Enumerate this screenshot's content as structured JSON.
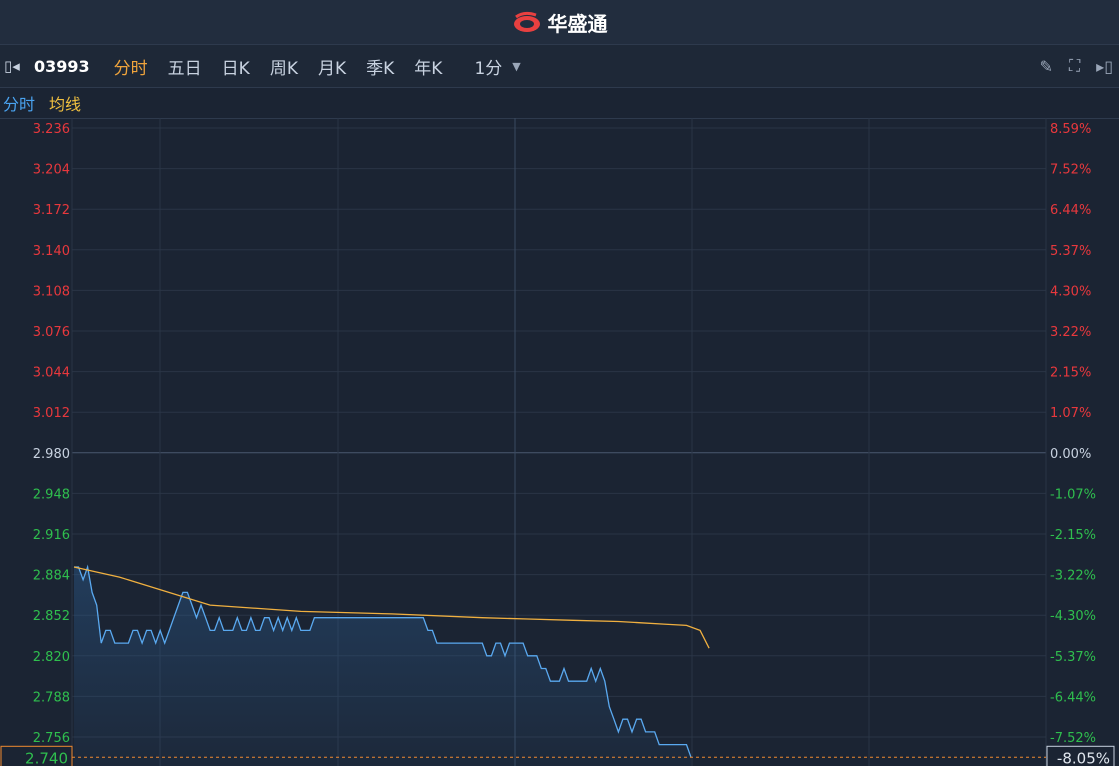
{
  "app": {
    "brand": "华盛通"
  },
  "toolbar": {
    "code": "03993",
    "tabs": [
      "分时",
      "五日",
      "日K",
      "周K",
      "月K",
      "季K",
      "年K"
    ],
    "active_tab": 0,
    "interval": "1分"
  },
  "legend": {
    "series1": "分时",
    "series2": "均线"
  },
  "colors": {
    "up": "#e8383d",
    "down": "#2fbf4e",
    "flat": "#c8d2e0",
    "price_line": "#5aa9f0",
    "avg_line": "#f0b040",
    "current": "#f08a30"
  },
  "chart_data": {
    "type": "line",
    "base_price": 2.98,
    "ylim": [
      2.74,
      3.236
    ],
    "price_ticks": [
      "3.236",
      "3.204",
      "3.172",
      "3.140",
      "3.108",
      "3.076",
      "3.044",
      "3.012",
      "2.980",
      "2.948",
      "2.916",
      "2.884",
      "2.852",
      "2.820",
      "2.788",
      "2.756"
    ],
    "pct_ticks": [
      "8.59%",
      "7.52%",
      "6.44%",
      "5.37%",
      "4.30%",
      "3.22%",
      "2.15%",
      "1.07%",
      "0.00%",
      "-1.07%",
      "-2.15%",
      "-3.22%",
      "-4.30%",
      "-5.37%",
      "-6.44%",
      "-7.52%"
    ],
    "current_price": "2.740",
    "current_pct": "-8.05%",
    "series": [
      {
        "name": "分时",
        "values": [
          2.89,
          2.89,
          2.88,
          2.89,
          2.87,
          2.86,
          2.83,
          2.84,
          2.84,
          2.83,
          2.83,
          2.83,
          2.83,
          2.84,
          2.84,
          2.83,
          2.84,
          2.84,
          2.83,
          2.84,
          2.83,
          2.84,
          2.85,
          2.86,
          2.87,
          2.87,
          2.86,
          2.85,
          2.86,
          2.85,
          2.84,
          2.84,
          2.85,
          2.84,
          2.84,
          2.84,
          2.85,
          2.84,
          2.84,
          2.85,
          2.84,
          2.84,
          2.85,
          2.85,
          2.84,
          2.85,
          2.84,
          2.85,
          2.84,
          2.85,
          2.84,
          2.84,
          2.84,
          2.85,
          2.85,
          2.85,
          2.85,
          2.85,
          2.85,
          2.85,
          2.85,
          2.85,
          2.85,
          2.85,
          2.85,
          2.85,
          2.85,
          2.85,
          2.85,
          2.85,
          2.85,
          2.85,
          2.85,
          2.85,
          2.85,
          2.85,
          2.85,
          2.85,
          2.84,
          2.84,
          2.83,
          2.83,
          2.83,
          2.83,
          2.83,
          2.83,
          2.83,
          2.83,
          2.83,
          2.83,
          2.83,
          2.82,
          2.82,
          2.83,
          2.83,
          2.82,
          2.83,
          2.83,
          2.83,
          2.83,
          2.82,
          2.82,
          2.82,
          2.81,
          2.81,
          2.8,
          2.8,
          2.8,
          2.81,
          2.8,
          2.8,
          2.8,
          2.8,
          2.8,
          2.81,
          2.8,
          2.81,
          2.8,
          2.78,
          2.77,
          2.76,
          2.77,
          2.77,
          2.76,
          2.77,
          2.77,
          2.76,
          2.76,
          2.76,
          2.75,
          2.75,
          2.75,
          2.75,
          2.75,
          2.75,
          2.75,
          2.74
        ]
      },
      {
        "name": "均线",
        "values": [
          2.89,
          2.882,
          2.86,
          2.855,
          2.853,
          2.85,
          2.849,
          2.848,
          2.847,
          2.846,
          2.845,
          2.844,
          2.84,
          2.826
        ]
      }
    ],
    "avg_x_positions": [
      0,
      10,
      30,
      50,
      70,
      90,
      100,
      110,
      120,
      125,
      130,
      135,
      138,
      140
    ],
    "x_gridlines": 5
  }
}
